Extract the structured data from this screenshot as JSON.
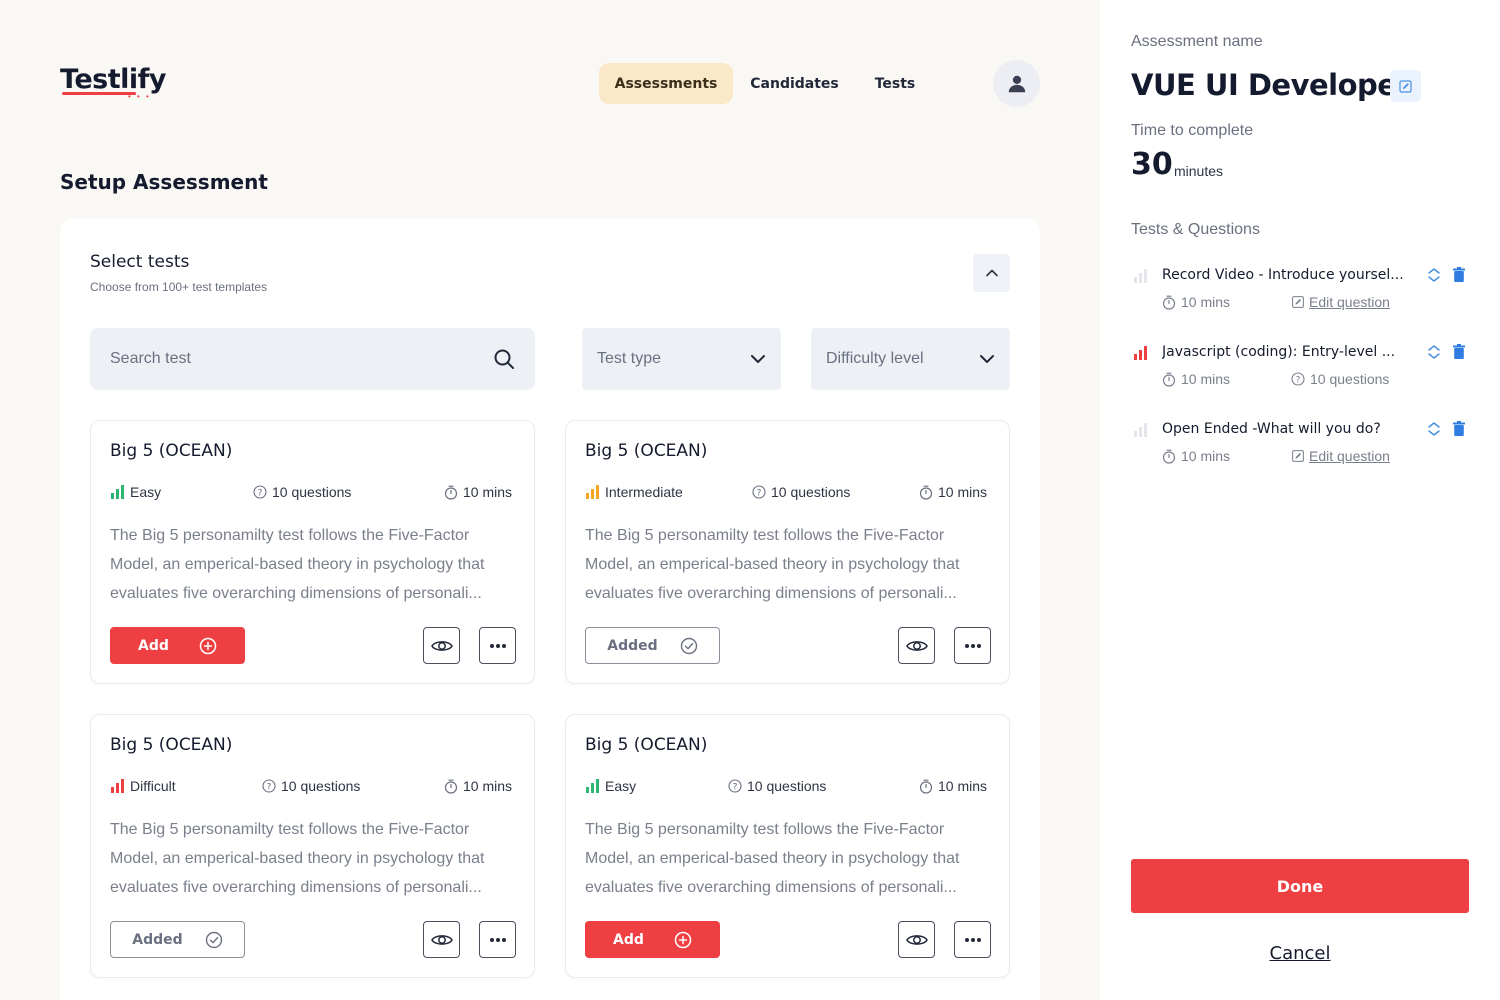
{
  "brand": {
    "name": "Testlify",
    "accent": "#ee3f43"
  },
  "nav": {
    "items": [
      {
        "label": "Assessments",
        "active": true
      },
      {
        "label": "Candidates",
        "active": false
      },
      {
        "label": "Tests",
        "active": false
      }
    ],
    "avatar_icon": "user-icon"
  },
  "page": {
    "title": "Setup Assessment"
  },
  "select_tests": {
    "title": "Select tests",
    "subtitle": "Choose from 100+ test templates",
    "collapse_icon": "chevron-up-icon"
  },
  "filters": {
    "search_placeholder": "Search test",
    "test_type": "Test type",
    "difficulty": "Difficulty level"
  },
  "cards": [
    {
      "title": "Big 5 (OCEAN)",
      "difficulty": "Easy",
      "difficulty_color": "#2bb673",
      "questions": "10 questions",
      "duration": "10 mins",
      "description": "The Big 5 personamilty test follows the Five-Factor Model, an emperical-based theory in psychology that evaluates five overarching dimensions of personali...",
      "action": "Add",
      "added": false
    },
    {
      "title": "Big 5 (OCEAN)",
      "difficulty": "Intermediate",
      "difficulty_color": "#f5a623",
      "questions": "10 questions",
      "duration": "10 mins",
      "description": "The Big 5 personamilty test follows the Five-Factor Model, an emperical-based theory in psychology that evaluates five overarching dimensions of personali...",
      "action": "Added",
      "added": true
    },
    {
      "title": "Big 5 (OCEAN)",
      "difficulty": "Difficult",
      "difficulty_color": "#ee3f43",
      "questions": "10 questions",
      "duration": "10 mins",
      "description": "The Big 5 personamilty test follows the Five-Factor Model, an emperical-based theory in psychology that evaluates five overarching dimensions of personali...",
      "action": "Added",
      "added": true
    },
    {
      "title": "Big 5 (OCEAN)",
      "difficulty": "Easy",
      "difficulty_color": "#2bb673",
      "questions": "10 questions",
      "duration": "10 mins",
      "description": "The Big 5 personamilty test follows the Five-Factor Model, an emperical-based theory in psychology that evaluates five overarching dimensions of personali...",
      "action": "Add",
      "added": false
    }
  ],
  "sidebar": {
    "name_label": "Assessment name",
    "name": "VUE UI Developer",
    "time_label": "Time to complete",
    "time_value": "30",
    "time_unit": "minutes",
    "tq_label": "Tests & Questions",
    "items": [
      {
        "title": "Record Video -  Introduce yoursel...",
        "duration": "10 mins",
        "secondary": "Edit question",
        "secondary_is_link": true,
        "level_color": "#e3e6ea"
      },
      {
        "title": "Javascript (coding): Entry-level ...",
        "duration": "10 mins",
        "secondary": "10 questions",
        "secondary_is_link": false,
        "level_color": "#ee3f43"
      },
      {
        "title": "Open Ended -What will you do?",
        "duration": "10 mins",
        "secondary": "Edit question",
        "secondary_is_link": true,
        "level_color": "#e3e6ea"
      }
    ],
    "done": "Done",
    "cancel": "Cancel"
  }
}
